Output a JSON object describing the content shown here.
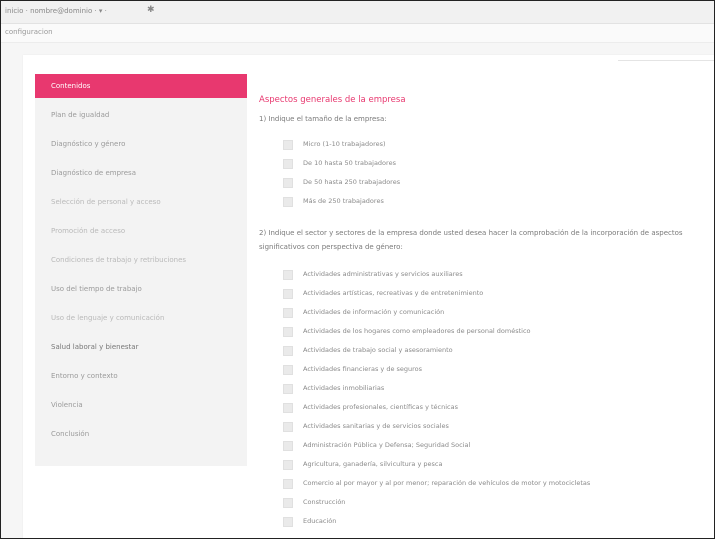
{
  "browser": {
    "address": "inicio · nombre@dominio · ▾ ·",
    "tab_icon": "gear-icon"
  },
  "breadcrumb": "configuracion",
  "sidebar": {
    "items": [
      {
        "label": "Contenidos"
      },
      {
        "label": "Plan de igualdad"
      },
      {
        "label": "Diagnóstico y género"
      },
      {
        "label": "Diagnóstico de empresa"
      },
      {
        "label": "Selección de personal y acceso"
      },
      {
        "label": "Promoción de acceso"
      },
      {
        "label": "Condiciones de trabajo y retribuciones"
      },
      {
        "label": "Uso del tiempo de trabajo"
      },
      {
        "label": "Uso de lenguaje y comunicación"
      },
      {
        "label": "Salud laboral y bienestar"
      },
      {
        "label": "Entorno y contexto"
      },
      {
        "label": "Violencia"
      },
      {
        "label": "Conclusión"
      }
    ]
  },
  "main": {
    "section_title": "Aspectos generales de la empresa",
    "q1": {
      "text": "1) Indique el tamaño de la empresa:",
      "options": [
        "Micro (1-10 trabajadores)",
        "De 10 hasta 50 trabajadores",
        "De 50 hasta 250 trabajadores",
        "Más de 250 trabajadores"
      ]
    },
    "q2": {
      "text": "2) Indique el sector y sectores de la empresa donde usted desea hacer la comprobación de la incorporación de aspectos significativos con perspectiva de género:",
      "options": [
        "Actividades administrativas y servicios auxiliares",
        "Actividades artísticas, recreativas y de entretenimiento",
        "Actividades de información y comunicación",
        "Actividades de los hogares como empleadores de personal doméstico",
        "Actividades de trabajo social y asesoramiento",
        "Actividades financieras y de seguros",
        "Actividades inmobiliarias",
        "Actividades profesionales, científicas y técnicas",
        "Actividades sanitarias y de servicios sociales",
        "Administración Pública y Defensa; Seguridad Social",
        "Agricultura, ganadería, silvicultura y pesca",
        "Comercio al por mayor y al por menor; reparación de vehículos de motor y motocicletas",
        "Construcción",
        "Educación"
      ]
    }
  }
}
